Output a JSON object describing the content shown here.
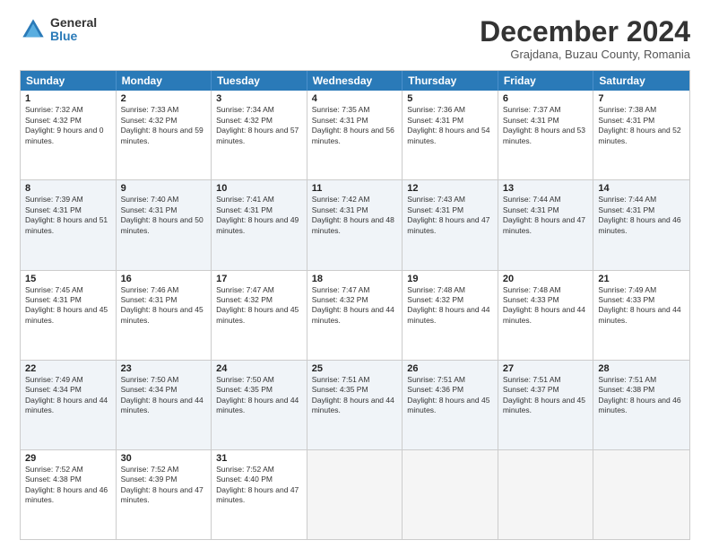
{
  "logo": {
    "general": "General",
    "blue": "Blue"
  },
  "title": "December 2024",
  "subtitle": "Grajdana, Buzau County, Romania",
  "days": [
    "Sunday",
    "Monday",
    "Tuesday",
    "Wednesday",
    "Thursday",
    "Friday",
    "Saturday"
  ],
  "weeks": [
    [
      {
        "day": "1",
        "sunrise": "Sunrise: 7:32 AM",
        "sunset": "Sunset: 4:32 PM",
        "daylight": "Daylight: 9 hours and 0 minutes."
      },
      {
        "day": "2",
        "sunrise": "Sunrise: 7:33 AM",
        "sunset": "Sunset: 4:32 PM",
        "daylight": "Daylight: 8 hours and 59 minutes."
      },
      {
        "day": "3",
        "sunrise": "Sunrise: 7:34 AM",
        "sunset": "Sunset: 4:32 PM",
        "daylight": "Daylight: 8 hours and 57 minutes."
      },
      {
        "day": "4",
        "sunrise": "Sunrise: 7:35 AM",
        "sunset": "Sunset: 4:31 PM",
        "daylight": "Daylight: 8 hours and 56 minutes."
      },
      {
        "day": "5",
        "sunrise": "Sunrise: 7:36 AM",
        "sunset": "Sunset: 4:31 PM",
        "daylight": "Daylight: 8 hours and 54 minutes."
      },
      {
        "day": "6",
        "sunrise": "Sunrise: 7:37 AM",
        "sunset": "Sunset: 4:31 PM",
        "daylight": "Daylight: 8 hours and 53 minutes."
      },
      {
        "day": "7",
        "sunrise": "Sunrise: 7:38 AM",
        "sunset": "Sunset: 4:31 PM",
        "daylight": "Daylight: 8 hours and 52 minutes."
      }
    ],
    [
      {
        "day": "8",
        "sunrise": "Sunrise: 7:39 AM",
        "sunset": "Sunset: 4:31 PM",
        "daylight": "Daylight: 8 hours and 51 minutes."
      },
      {
        "day": "9",
        "sunrise": "Sunrise: 7:40 AM",
        "sunset": "Sunset: 4:31 PM",
        "daylight": "Daylight: 8 hours and 50 minutes."
      },
      {
        "day": "10",
        "sunrise": "Sunrise: 7:41 AM",
        "sunset": "Sunset: 4:31 PM",
        "daylight": "Daylight: 8 hours and 49 minutes."
      },
      {
        "day": "11",
        "sunrise": "Sunrise: 7:42 AM",
        "sunset": "Sunset: 4:31 PM",
        "daylight": "Daylight: 8 hours and 48 minutes."
      },
      {
        "day": "12",
        "sunrise": "Sunrise: 7:43 AM",
        "sunset": "Sunset: 4:31 PM",
        "daylight": "Daylight: 8 hours and 47 minutes."
      },
      {
        "day": "13",
        "sunrise": "Sunrise: 7:44 AM",
        "sunset": "Sunset: 4:31 PM",
        "daylight": "Daylight: 8 hours and 47 minutes."
      },
      {
        "day": "14",
        "sunrise": "Sunrise: 7:44 AM",
        "sunset": "Sunset: 4:31 PM",
        "daylight": "Daylight: 8 hours and 46 minutes."
      }
    ],
    [
      {
        "day": "15",
        "sunrise": "Sunrise: 7:45 AM",
        "sunset": "Sunset: 4:31 PM",
        "daylight": "Daylight: 8 hours and 45 minutes."
      },
      {
        "day": "16",
        "sunrise": "Sunrise: 7:46 AM",
        "sunset": "Sunset: 4:31 PM",
        "daylight": "Daylight: 8 hours and 45 minutes."
      },
      {
        "day": "17",
        "sunrise": "Sunrise: 7:47 AM",
        "sunset": "Sunset: 4:32 PM",
        "daylight": "Daylight: 8 hours and 45 minutes."
      },
      {
        "day": "18",
        "sunrise": "Sunrise: 7:47 AM",
        "sunset": "Sunset: 4:32 PM",
        "daylight": "Daylight: 8 hours and 44 minutes."
      },
      {
        "day": "19",
        "sunrise": "Sunrise: 7:48 AM",
        "sunset": "Sunset: 4:32 PM",
        "daylight": "Daylight: 8 hours and 44 minutes."
      },
      {
        "day": "20",
        "sunrise": "Sunrise: 7:48 AM",
        "sunset": "Sunset: 4:33 PM",
        "daylight": "Daylight: 8 hours and 44 minutes."
      },
      {
        "day": "21",
        "sunrise": "Sunrise: 7:49 AM",
        "sunset": "Sunset: 4:33 PM",
        "daylight": "Daylight: 8 hours and 44 minutes."
      }
    ],
    [
      {
        "day": "22",
        "sunrise": "Sunrise: 7:49 AM",
        "sunset": "Sunset: 4:34 PM",
        "daylight": "Daylight: 8 hours and 44 minutes."
      },
      {
        "day": "23",
        "sunrise": "Sunrise: 7:50 AM",
        "sunset": "Sunset: 4:34 PM",
        "daylight": "Daylight: 8 hours and 44 minutes."
      },
      {
        "day": "24",
        "sunrise": "Sunrise: 7:50 AM",
        "sunset": "Sunset: 4:35 PM",
        "daylight": "Daylight: 8 hours and 44 minutes."
      },
      {
        "day": "25",
        "sunrise": "Sunrise: 7:51 AM",
        "sunset": "Sunset: 4:35 PM",
        "daylight": "Daylight: 8 hours and 44 minutes."
      },
      {
        "day": "26",
        "sunrise": "Sunrise: 7:51 AM",
        "sunset": "Sunset: 4:36 PM",
        "daylight": "Daylight: 8 hours and 45 minutes."
      },
      {
        "day": "27",
        "sunrise": "Sunrise: 7:51 AM",
        "sunset": "Sunset: 4:37 PM",
        "daylight": "Daylight: 8 hours and 45 minutes."
      },
      {
        "day": "28",
        "sunrise": "Sunrise: 7:51 AM",
        "sunset": "Sunset: 4:38 PM",
        "daylight": "Daylight: 8 hours and 46 minutes."
      }
    ],
    [
      {
        "day": "29",
        "sunrise": "Sunrise: 7:52 AM",
        "sunset": "Sunset: 4:38 PM",
        "daylight": "Daylight: 8 hours and 46 minutes."
      },
      {
        "day": "30",
        "sunrise": "Sunrise: 7:52 AM",
        "sunset": "Sunset: 4:39 PM",
        "daylight": "Daylight: 8 hours and 47 minutes."
      },
      {
        "day": "31",
        "sunrise": "Sunrise: 7:52 AM",
        "sunset": "Sunset: 4:40 PM",
        "daylight": "Daylight: 8 hours and 47 minutes."
      },
      {
        "day": "",
        "sunrise": "",
        "sunset": "",
        "daylight": ""
      },
      {
        "day": "",
        "sunrise": "",
        "sunset": "",
        "daylight": ""
      },
      {
        "day": "",
        "sunrise": "",
        "sunset": "",
        "daylight": ""
      },
      {
        "day": "",
        "sunrise": "",
        "sunset": "",
        "daylight": ""
      }
    ]
  ]
}
